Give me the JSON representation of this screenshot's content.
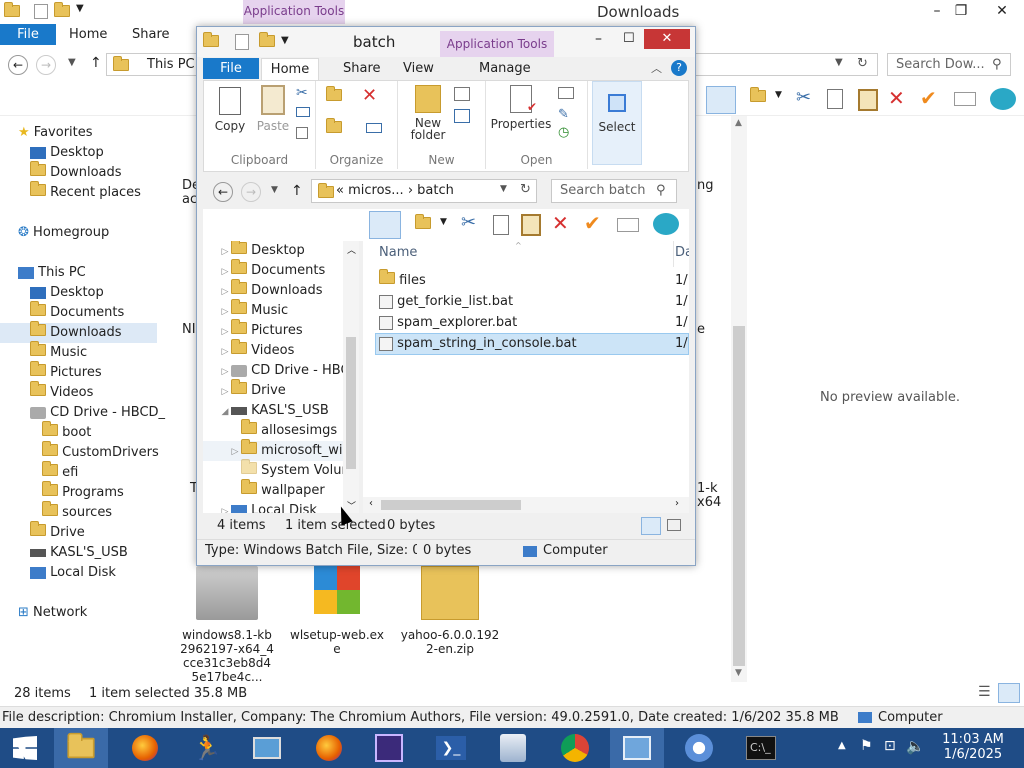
{
  "bg": {
    "title": "Downloads",
    "app_tools": "Application Tools",
    "tabs": [
      "File",
      "Home",
      "Share"
    ],
    "address": "This PC",
    "search_placeholder": "Search Dow...",
    "nav": {
      "favorites": "Favorites",
      "favorites_items": [
        "Desktop",
        "Downloads",
        "Recent places"
      ],
      "homegroup": "Homegroup",
      "thispc": "This PC",
      "thispc_items": [
        "Desktop",
        "Documents",
        "Downloads",
        "Music",
        "Pictures",
        "Videos",
        "CD Drive - HBCD_"
      ],
      "cd_items": [
        "boot",
        "CustomDrivers",
        "efi",
        "Programs",
        "sources"
      ],
      "other_items": [
        "Drive",
        "KASL'S_USB",
        "Local Disk"
      ],
      "network": "Network"
    },
    "partial_labels": [
      "De",
      "ac",
      "NI",
      "ng",
      "e",
      "1-k",
      "x64",
      "T"
    ],
    "files_bottom": [
      "windows8.1-kb2962197-x64_4cce31c3eb8d45e17be4c...",
      "wlsetup-web.exe",
      "yahoo-6.0.0.1922-en.zip"
    ],
    "preview": "No preview available.",
    "status_items": "28 items",
    "status_selected": "1 item selected  35.8 MB",
    "info_bar": "File description: Chromium Installer, Company: The Chromium Authors, File version: 49.0.2591.0, Date created: 1/6/202 35.8 MB",
    "info_computer": "Computer"
  },
  "win": {
    "title": "batch",
    "app_tools": "Application Tools",
    "tabs": [
      "File",
      "Home",
      "Share",
      "View",
      "Manage"
    ],
    "ribbon": {
      "copy": "Copy",
      "paste": "Paste",
      "clipboard": "Clipboard",
      "organize": "Organize",
      "new_folder_1": "New",
      "new_folder_2": "folder",
      "new": "New",
      "properties": "Properties",
      "open": "Open",
      "select": "Select"
    },
    "address": "« micros... › batch",
    "search_placeholder": "Search batch",
    "tree": [
      "Desktop",
      "Documents",
      "Downloads",
      "Music",
      "Pictures",
      "Videos",
      "CD Drive - HBC",
      "Drive",
      "KASL'S_USB",
      "allosesimgs",
      "microsoft_wi",
      "System Volur",
      "wallpaper",
      "Local Disk"
    ],
    "col_name": "Name",
    "col_date": "Da",
    "files": [
      {
        "name": "files",
        "date": "1/"
      },
      {
        "name": "get_forkie_list.bat",
        "date": "1/"
      },
      {
        "name": "spam_explorer.bat",
        "date": "1/"
      },
      {
        "name": "spam_string_in_console.bat",
        "date": "1/"
      }
    ],
    "status_items": "4 items",
    "status_selected": "1 item selected",
    "status_bytes": "0 bytes",
    "info": "Type: Windows Batch File, Size: 0",
    "info_bytes": "0 bytes",
    "info_computer": "Computer"
  },
  "taskbar": {
    "time": "11:03 AM",
    "date": "1/6/2025"
  },
  "colors": {
    "accent": "#1979ca",
    "selection": "#cce4f7",
    "taskbar": "#1f4c86"
  }
}
